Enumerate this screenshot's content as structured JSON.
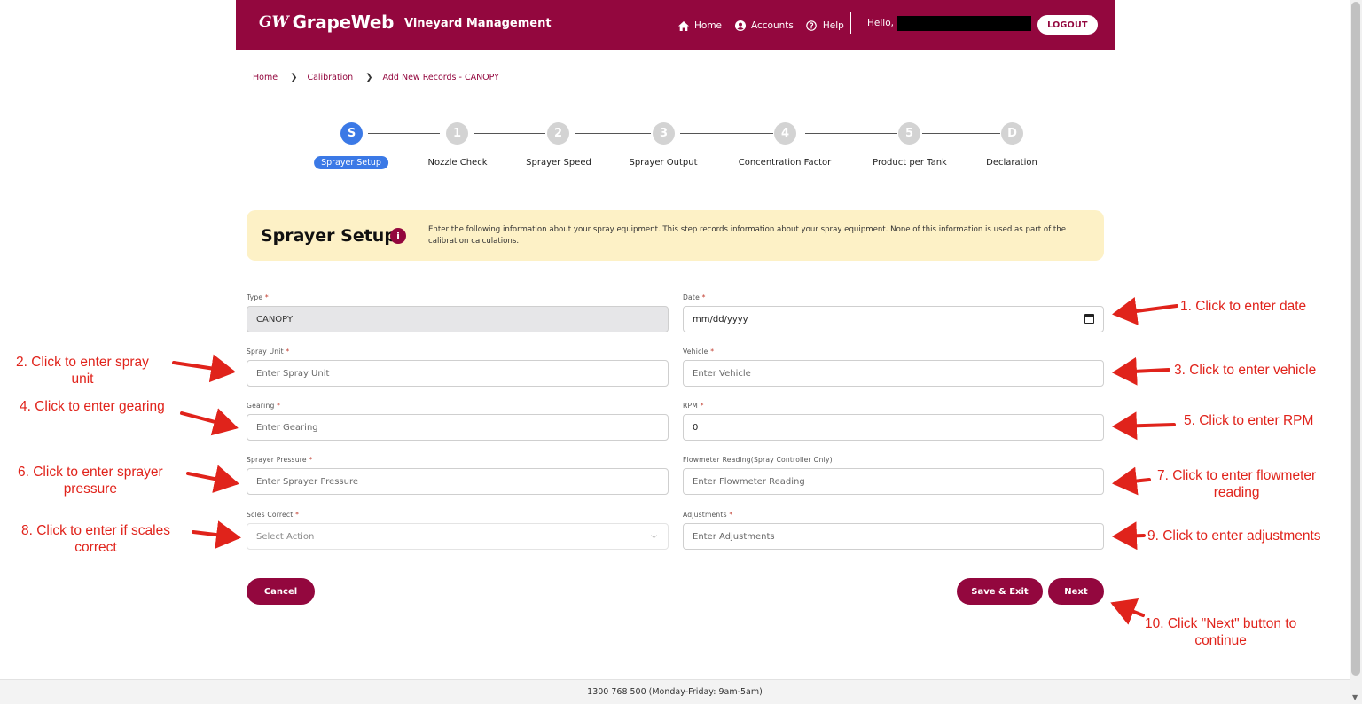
{
  "header": {
    "logo_mark": "GW",
    "logo_text": "GrapeWeb",
    "app_title": "Vineyard Management",
    "nav": [
      {
        "label": "Home",
        "icon": "home-icon"
      },
      {
        "label": "Accounts",
        "icon": "user-circle-icon"
      },
      {
        "label": "Help",
        "icon": "help-circle-icon"
      }
    ],
    "hello": "Hello,",
    "logout": "LOGOUT"
  },
  "breadcrumb": [
    "Home",
    "Calibration",
    "Add New Records - CANOPY"
  ],
  "stepper": {
    "steps": [
      {
        "mark": "S",
        "label": "Sprayer Setup",
        "active": true
      },
      {
        "mark": "1",
        "label": "Nozzle Check",
        "active": false
      },
      {
        "mark": "2",
        "label": "Sprayer Speed",
        "active": false
      },
      {
        "mark": "3",
        "label": "Sprayer Output",
        "active": false
      },
      {
        "mark": "4",
        "label": "Concentration Factor",
        "active": false
      },
      {
        "mark": "5",
        "label": "Product per Tank",
        "active": false
      },
      {
        "mark": "D",
        "label": "Declaration",
        "active": false
      }
    ]
  },
  "info": {
    "title": "Sprayer Setup",
    "icon": "i",
    "text": "Enter the following information about your spray equipment. This step records information about your spray equipment. None of this information is used as part of the calibration calculations."
  },
  "form": {
    "type": {
      "label": "Type",
      "value": "CANOPY"
    },
    "date": {
      "label": "Date",
      "placeholder": "mm/dd/yyyy"
    },
    "spray_unit": {
      "label": "Spray Unit",
      "placeholder": "Enter Spray Unit"
    },
    "vehicle": {
      "label": "Vehicle",
      "placeholder": "Enter Vehicle"
    },
    "gearing": {
      "label": "Gearing",
      "placeholder": "Enter Gearing"
    },
    "rpm": {
      "label": "RPM",
      "value": "0"
    },
    "sprayer_pressure": {
      "label": "Sprayer Pressure",
      "placeholder": "Enter Sprayer Pressure"
    },
    "flowmeter": {
      "label": "Flowmeter Reading(Spray Controller Only)",
      "placeholder": "Enter Flowmeter Reading"
    },
    "scales": {
      "label": "Scles Correct",
      "placeholder": "Select Action"
    },
    "adjustments": {
      "label": "Adjustments",
      "placeholder": "Enter Adjustments"
    },
    "required_mark": "*"
  },
  "buttons": {
    "cancel": "Cancel",
    "save_exit": "Save & Exit",
    "next": "Next"
  },
  "footer": {
    "text": "1300 768 500 (Monday-Friday: 9am-5am)"
  },
  "annotations": {
    "a1": "1. Click to enter date",
    "a2": "2. Click to enter spray\nunit",
    "a3": "3. Click to enter vehicle",
    "a4": "4. Click to enter gearing",
    "a5": "5. Click to enter RPM",
    "a6": "6. Click to enter sprayer\npressure",
    "a7": "7. Click to enter flowmeter\nreading",
    "a8": "8. Click to enter if scales\ncorrect",
    "a9": "9. Click to enter adjustments",
    "a10": "10. Click \"Next\" button to\ncontinue"
  },
  "colors": {
    "brand": "#93073e",
    "active_step": "#3b79e6",
    "info_bg": "#fdf1c6",
    "annotation": "#e0231b"
  }
}
